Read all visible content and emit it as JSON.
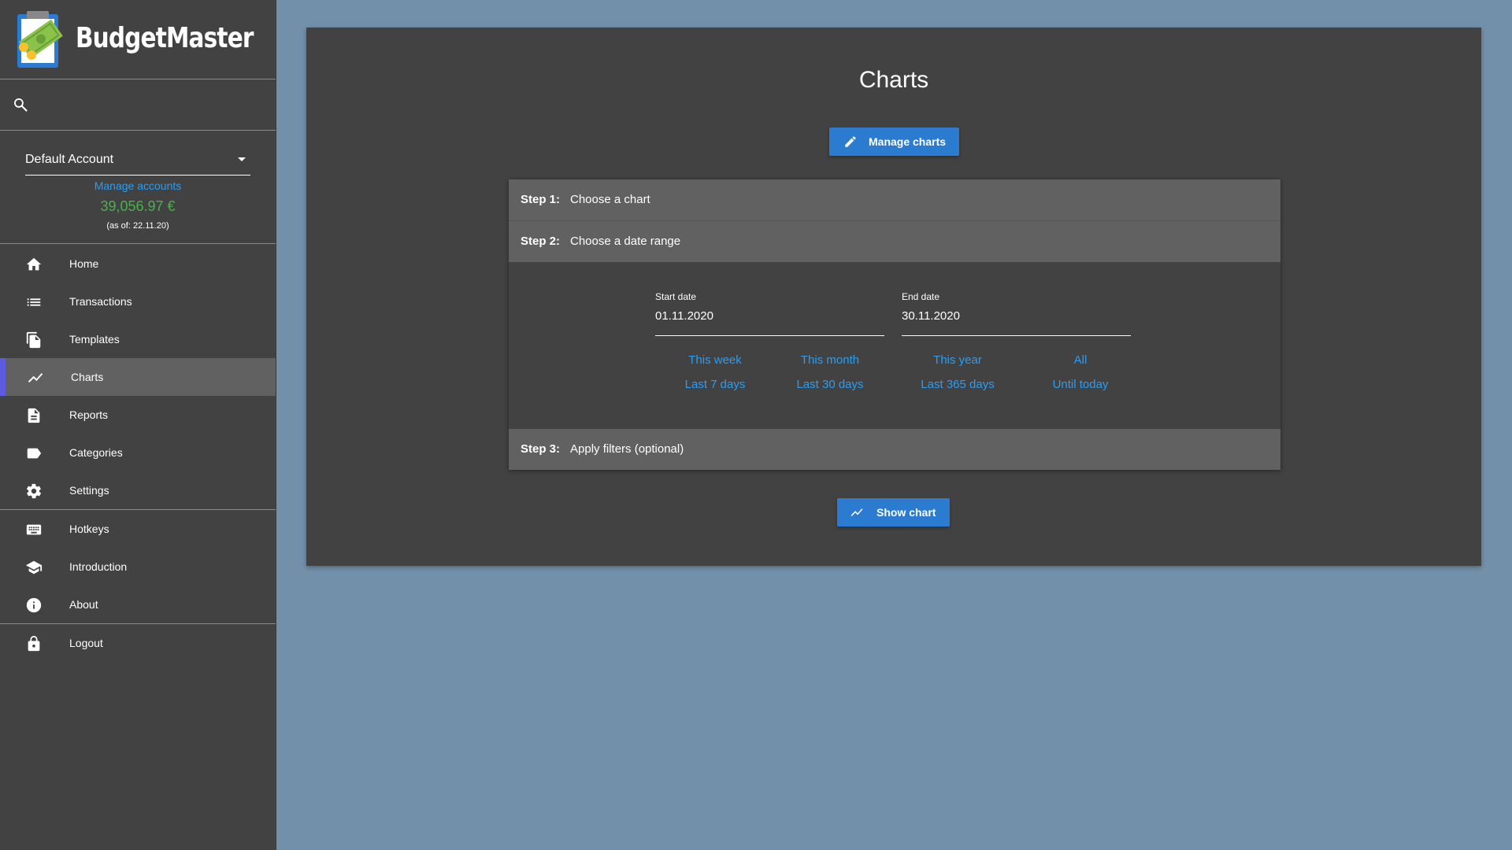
{
  "app": {
    "title": "BudgetMaster"
  },
  "sidebar": {
    "account": {
      "selected": "Default Account",
      "manage_link": "Manage accounts",
      "balance": "39,056.97 €",
      "as_of": "(as of: 22.11.20)"
    },
    "nav_main": [
      {
        "label": "Home",
        "icon": "home-icon"
      },
      {
        "label": "Transactions",
        "icon": "list-icon"
      },
      {
        "label": "Templates",
        "icon": "copy-icon"
      },
      {
        "label": "Charts",
        "icon": "chart-line-icon",
        "active": true
      },
      {
        "label": "Reports",
        "icon": "document-icon"
      },
      {
        "label": "Categories",
        "icon": "label-icon"
      },
      {
        "label": "Settings",
        "icon": "gear-icon"
      }
    ],
    "nav_secondary": [
      {
        "label": "Hotkeys",
        "icon": "keyboard-icon"
      },
      {
        "label": "Introduction",
        "icon": "graduation-cap-icon"
      },
      {
        "label": "About",
        "icon": "info-icon"
      }
    ],
    "nav_logout": [
      {
        "label": "Logout",
        "icon": "lock-icon"
      }
    ]
  },
  "main": {
    "title": "Charts",
    "manage_button": "Manage charts",
    "show_button": "Show chart",
    "steps": [
      {
        "num": "Step 1:",
        "text": "Choose a chart"
      },
      {
        "num": "Step 2:",
        "text": "Choose a date range"
      },
      {
        "num": "Step 3:",
        "text": "Apply filters (optional)"
      }
    ],
    "start_date": {
      "label": "Start date",
      "value": "01.11.2020"
    },
    "end_date": {
      "label": "End date",
      "value": "30.11.2020"
    },
    "quick_ranges": [
      "This week",
      "This month",
      "This year",
      "All",
      "Last 7 days",
      "Last 30 days",
      "Last 365 days",
      "Until today"
    ]
  },
  "colors": {
    "sidebar_bg": "#424242",
    "page_bg": "#7390aa",
    "accent_blue": "#2b7cd0",
    "link_blue": "#2a9df4",
    "balance_green": "#4caf50",
    "active_indicator": "#5c5ce0"
  }
}
